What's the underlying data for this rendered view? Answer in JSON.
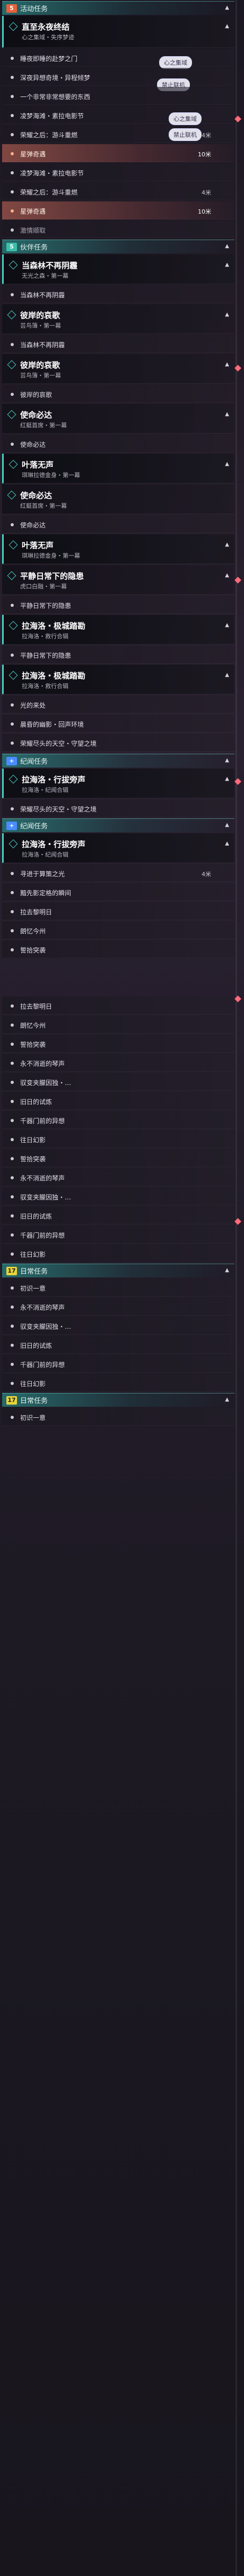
{
  "sections": {
    "activity": {
      "label": "活动任务",
      "icon": "5",
      "color": "#e8603a"
    },
    "companion": {
      "label": "伙伴任务",
      "icon": "5",
      "color": "#3cbfa8"
    },
    "legend": {
      "label": "纪闻任务",
      "icon": "+",
      "color": "#4a8cff"
    },
    "daily": {
      "label": "日常任务",
      "icon": "17",
      "color": "#e6d33a"
    }
  },
  "badges": {
    "heart_realm": "心之集域",
    "forbidden_bond": "禁止联机",
    "heart_realm_2": "心之集域",
    "forbidden_bond_2": "禁止联机"
  },
  "quests": {
    "dream_end": {
      "title": "直至永夜终结",
      "subtitle": "心之集域・失序梦迹"
    },
    "forest": {
      "title": "当森林不再阴霾",
      "subtitle": "无光之森・第一幕"
    },
    "lament": {
      "title": "彼岸的哀歌",
      "subtitle": "芸鸟簿・第一幕"
    },
    "must_reach": {
      "title": "使命必达",
      "subtitle": "红蜓首席・第一幕"
    },
    "leaf_no_sound": {
      "title": "叶落无声",
      "subtitle": "琪琳拉德金身・第一幕"
    },
    "calm_hidden": {
      "title": "平静日常下的隐患",
      "subtitle": "虎口白融・第一幕"
    },
    "lahailuo_defense": {
      "title": "拉海洛・极城踏勘",
      "subtitle": "拉海洛・救行合辑"
    },
    "lahailuo_echo": {
      "title": "拉海洛・行拔旁声",
      "subtitle": "拉海洛・纪闻合辑"
    }
  },
  "steps": {
    "s_gate": "睡夜即睡的赴梦之门",
    "s_deep": "深夜异想奇境・异程倾梦",
    "s_dream": "一个非常非常想要的东西",
    "s_festival": "凌梦海滩・素拉电影节",
    "s_glory": "荣耀之后：游斗重燃",
    "s_glory_amt": "4米",
    "s_star": "星弹奇遇",
    "s_star_amt": "10米",
    "s_festival2": "凌梦海滩・素拉电影节",
    "s_glory2": "荣耀之后：游斗重燃",
    "s_glory2_amt": "4米",
    "s_star2": "星弹奇遇",
    "s_star2_amt": "10米",
    "s_tune": "激情顺取",
    "s_forest_step": "当森林不再阴霾",
    "s_forest_step2": "当森林不再阴霾",
    "s_lament": "彼岸的哀歌",
    "s_reach": "使命必达",
    "s_calm": "平静日常下的隐患",
    "s_calm2": "平静日常下的隐患",
    "s_light": "光的来处",
    "s_dawn": "晨昏的幽影・回声环境",
    "s_grave": "荣耀尽头的天空・守望之境",
    "s_grave2": "荣耀尽头的天空・守望之境",
    "s_seek": "寻进于算策之光",
    "s_seek_amt": "4米",
    "s_shadow": "黯先影定格的瞬间",
    "s_silver": "拉去黎明日",
    "s_memory": "朗忆今州",
    "s_surprise": "誓拾突袭",
    "s_silver2": "拉去黎明日",
    "s_memory2": "朗忆今州",
    "s_surprise2": "誓拾突袭",
    "s_forever": "永不消逝的琴声",
    "s_guard": "驭变夹朦因独・…",
    "s_past": "旧日的试炼",
    "s_gate1000": "千器门前的异想",
    "s_ji": "往日幻影",
    "s_surprise3": "誓拾突袭",
    "s_forever2": "永不消逝的琴声",
    "s_guard2": "驭变夹朦因独・…",
    "s_past2": "旧日的试炼",
    "s_gate2": "千器门前的异想",
    "s_ji2": "往日幻影",
    "s_first": "初识一意",
    "s_forever3": "永不消逝的琴声",
    "s_guard3": "驭变夹朦因独・…",
    "s_past3": "旧日的试炼",
    "s_gate3": "千器门前的异想",
    "s_ji3": "往日幻影",
    "s_first2": "初识一意"
  }
}
